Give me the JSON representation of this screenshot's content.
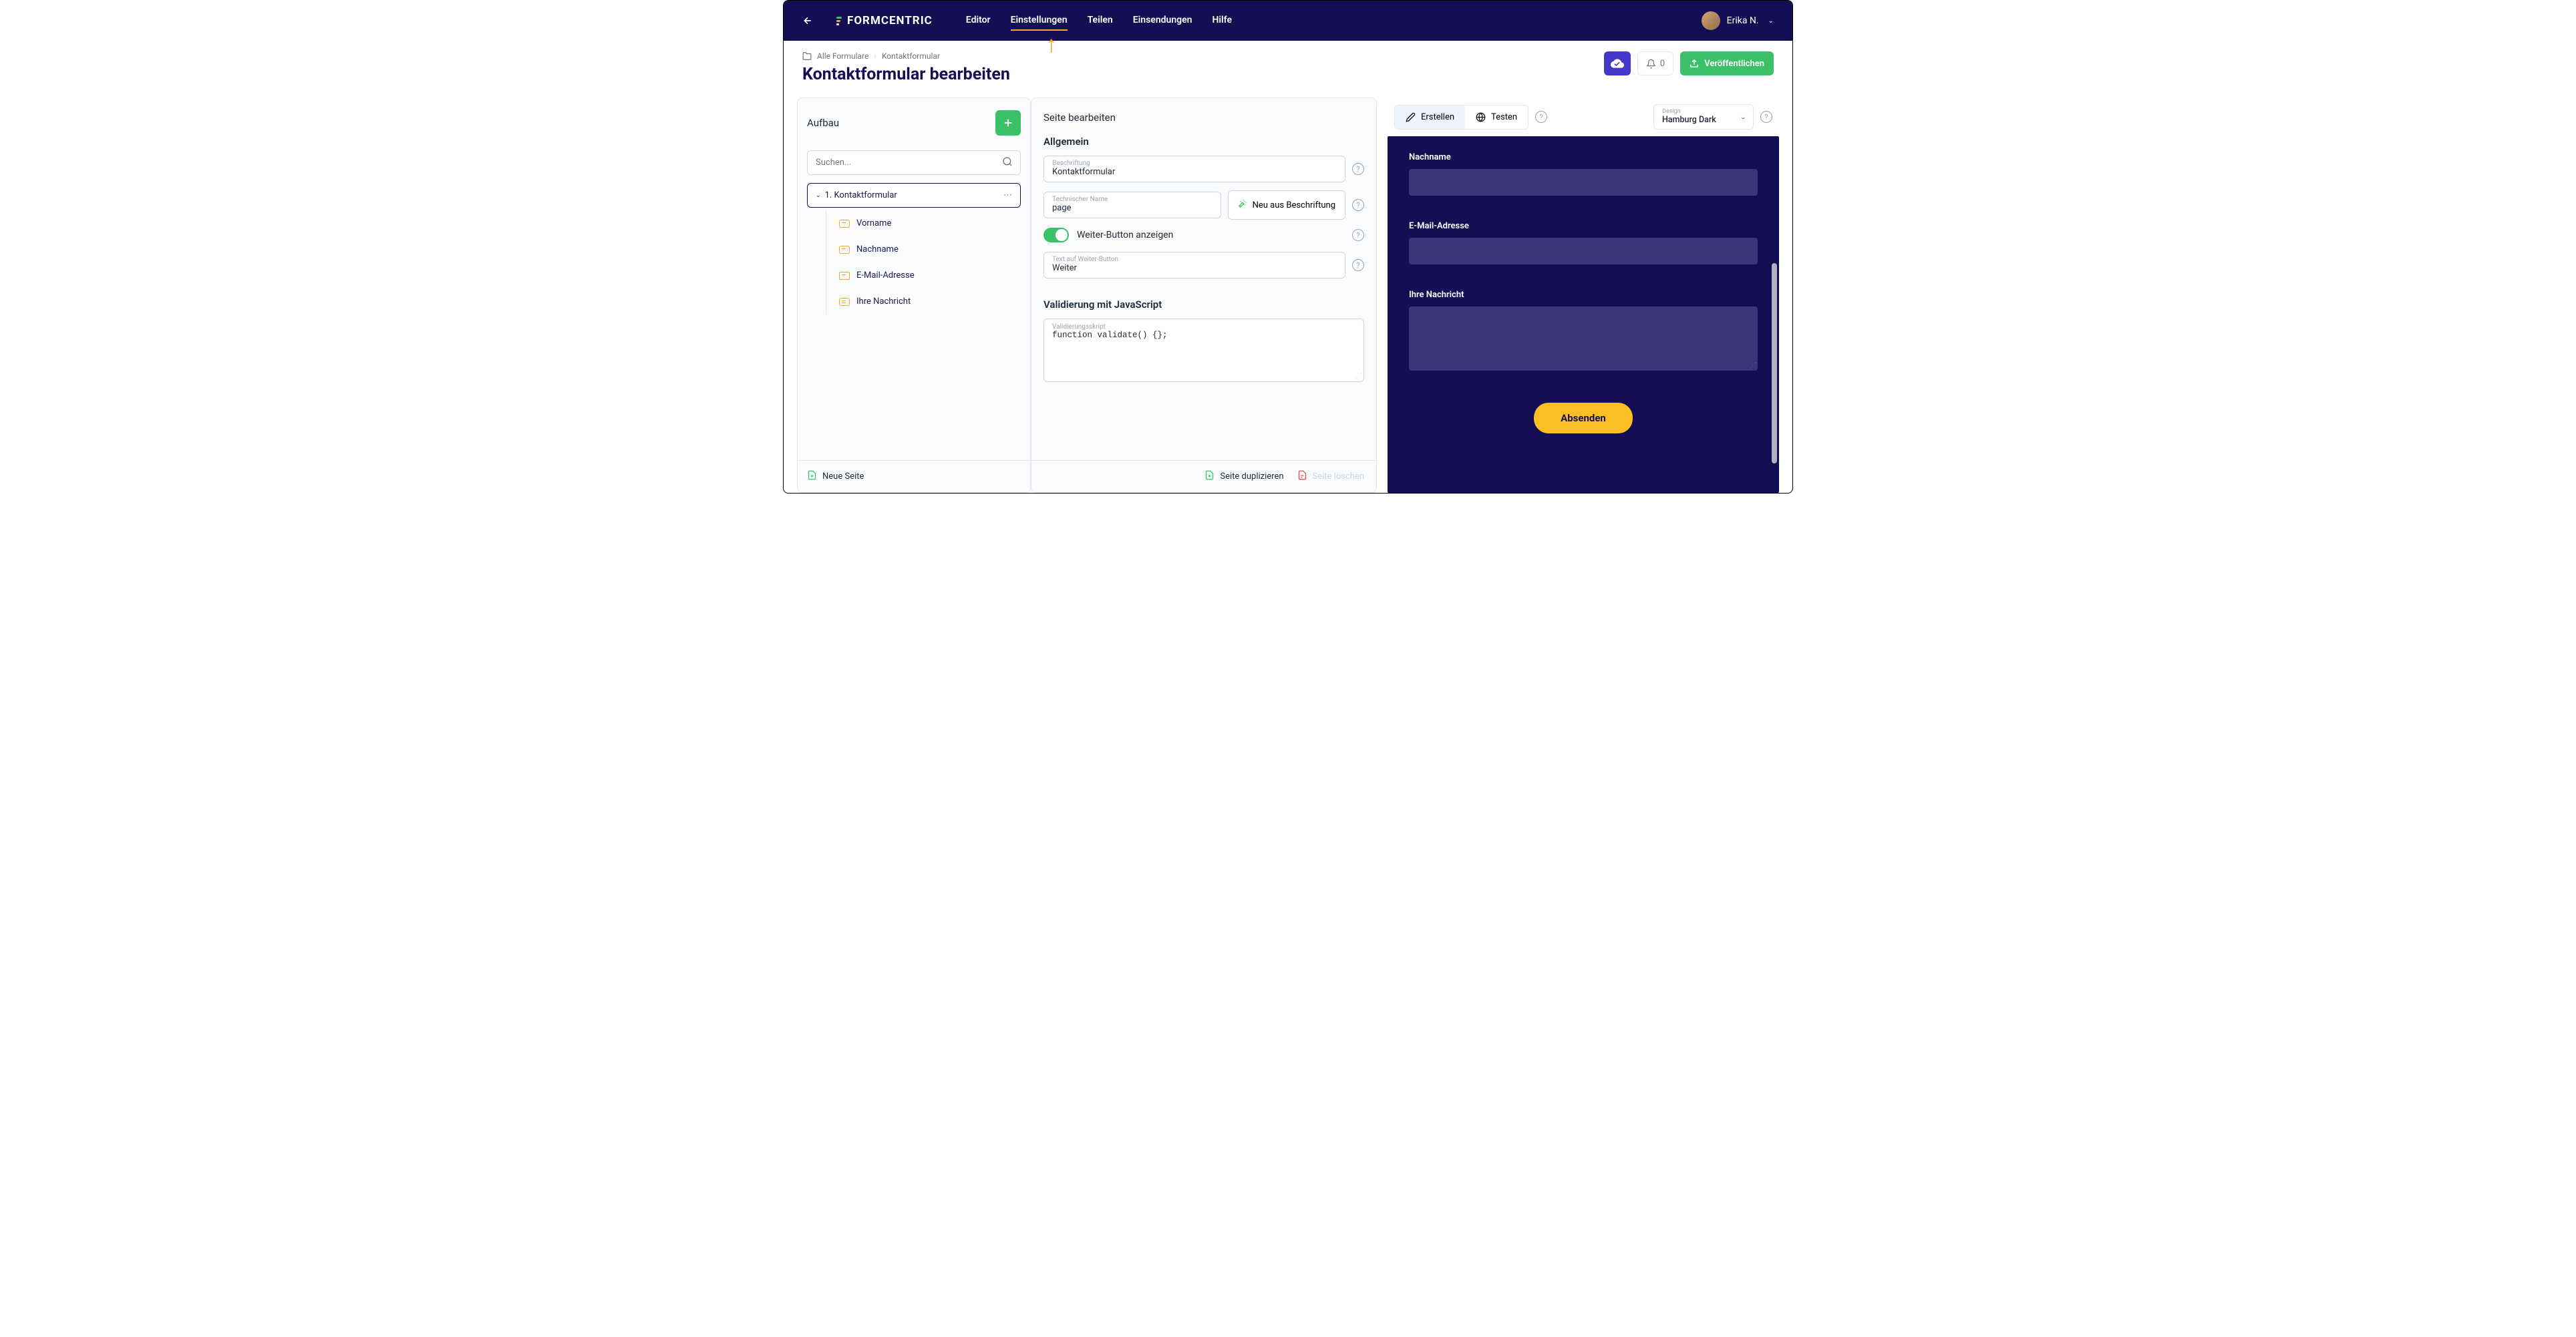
{
  "brand": "FORMCENTRIC",
  "nav": {
    "items": [
      {
        "label": "Editor"
      },
      {
        "label": "Einstellungen"
      },
      {
        "label": "Teilen"
      },
      {
        "label": "Einsendungen"
      },
      {
        "label": "Hilfe"
      }
    ],
    "active_index": 1
  },
  "user": {
    "name": "Erika N."
  },
  "breadcrumb": {
    "root": "Alle Formulare",
    "current": "Kontaktformular"
  },
  "page_title": "Kontaktformular bearbeiten",
  "actions": {
    "notifications_count": "0",
    "publish_label": "Veröffentlichen"
  },
  "aufbau": {
    "title": "Aufbau",
    "search_placeholder": "Suchen...",
    "root": "1. Kontaktformular",
    "fields": [
      {
        "label": "Vorname",
        "type": "text"
      },
      {
        "label": "Nachname",
        "type": "text"
      },
      {
        "label": "E-Mail-Adresse",
        "type": "email"
      },
      {
        "label": "Ihre Nachricht",
        "type": "textarea"
      }
    ],
    "new_page": "Neue Seite"
  },
  "edit": {
    "title": "Seite bearbeiten",
    "section_general": "Allgemein",
    "beschriftung": {
      "label": "Beschriftung",
      "value": "Kontaktformular"
    },
    "technischer_name": {
      "label": "Technischer Name",
      "value": "page"
    },
    "neu_aus_label": "Neu aus Beschriftung",
    "toggle_label": "Weiter-Button anzeigen",
    "weiter_text": {
      "label": "Text auf Weiter-Button",
      "value": "Weiter"
    },
    "section_validation": "Validierung mit JavaScript",
    "validation_script": {
      "label": "Validierungsskript",
      "value": "function validate() {};"
    },
    "footer": {
      "duplicate": "Seite duplizieren",
      "delete": "Seite löschen"
    }
  },
  "preview": {
    "tabs": {
      "create": "Erstellen",
      "test": "Testen"
    },
    "design": {
      "label": "Design",
      "value": "Hamburg Dark"
    },
    "fields": {
      "nachname": "Nachname",
      "email": "E-Mail-Adresse",
      "nachricht": "Ihre Nachricht"
    },
    "submit_label": "Absenden"
  }
}
